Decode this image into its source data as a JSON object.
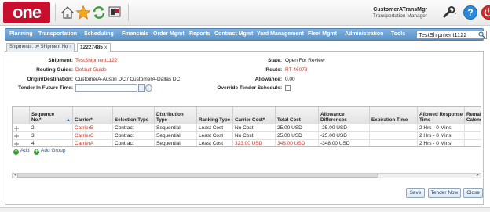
{
  "header": {
    "logo_text": "one",
    "user_name": "CustomerATransMgr",
    "user_role": "Transportation Manager",
    "help_label": "?"
  },
  "nav": {
    "items": [
      "Planning",
      "Transportation",
      "Scheduling",
      "Financials",
      "Order Mgmt",
      "Reports",
      "Contract Mgmt",
      "Yard Management",
      "Fleet Mgmt",
      "Administration",
      "Tools"
    ],
    "search_value": "TestShipment1122"
  },
  "tabs": [
    {
      "label": "Shipments: by Shipment No",
      "close": "x"
    },
    {
      "label": "12227485",
      "close": "x"
    }
  ],
  "form": {
    "shipment_label": "Shipment:",
    "shipment_value": "TestShipment1122",
    "routing_guide_label": "Routing Guide:",
    "routing_guide_value": "Default Guide",
    "origin_label": "Origin/Destination:",
    "origin_value": "CustomerA-Austin DC / CustomerA-Dallas DC",
    "tender_future_label": "Tender In Future Time:",
    "state_label": "State:",
    "state_value": "Open For Review",
    "route_label": "Route:",
    "route_value": "RT-46073",
    "allowance_label": "Allowance:",
    "allowance_value": "0.00",
    "override_label": "Override Tender Schedule:"
  },
  "grid": {
    "columns": [
      "Sequence No.*",
      "Carrier*",
      "Selection Type",
      "Distribution Type",
      "Ranking Type",
      "Carrier Cost*",
      "Total Cost",
      "Allowance Differences",
      "Expiration Time",
      "Allowed Response Time",
      "Remain Calendar"
    ],
    "rows": [
      [
        "2",
        "CarrierB",
        "Contract",
        "Sequential",
        "Least Cost",
        "No Cost",
        "25.00 USD",
        "-25.00 USD",
        "",
        "2 Hrs - 0 Mins"
      ],
      [
        "3",
        "CarrierC",
        "Contract",
        "Sequential",
        "Least Cost",
        "No Cost",
        "25.00 USD",
        "-25.00 USD",
        "",
        "2 Hrs - 0 Mins"
      ],
      [
        "4",
        "CarrierA",
        "Contract",
        "Sequential",
        "Least Cost",
        "323.00 USD",
        "348.00 USD",
        "-348.00 USD",
        "",
        "2 Hrs - 0 Mins"
      ]
    ],
    "sort_indicator": "▲"
  },
  "actions": {
    "add_label": "Add",
    "add_group_label": "Add Group",
    "save_label": "Save",
    "tender_now_label": "Tender Now",
    "close_label": "Close"
  },
  "colors": {
    "accent": "#c8102e",
    "nav": "#5b92c9",
    "link": "#c0392b"
  }
}
